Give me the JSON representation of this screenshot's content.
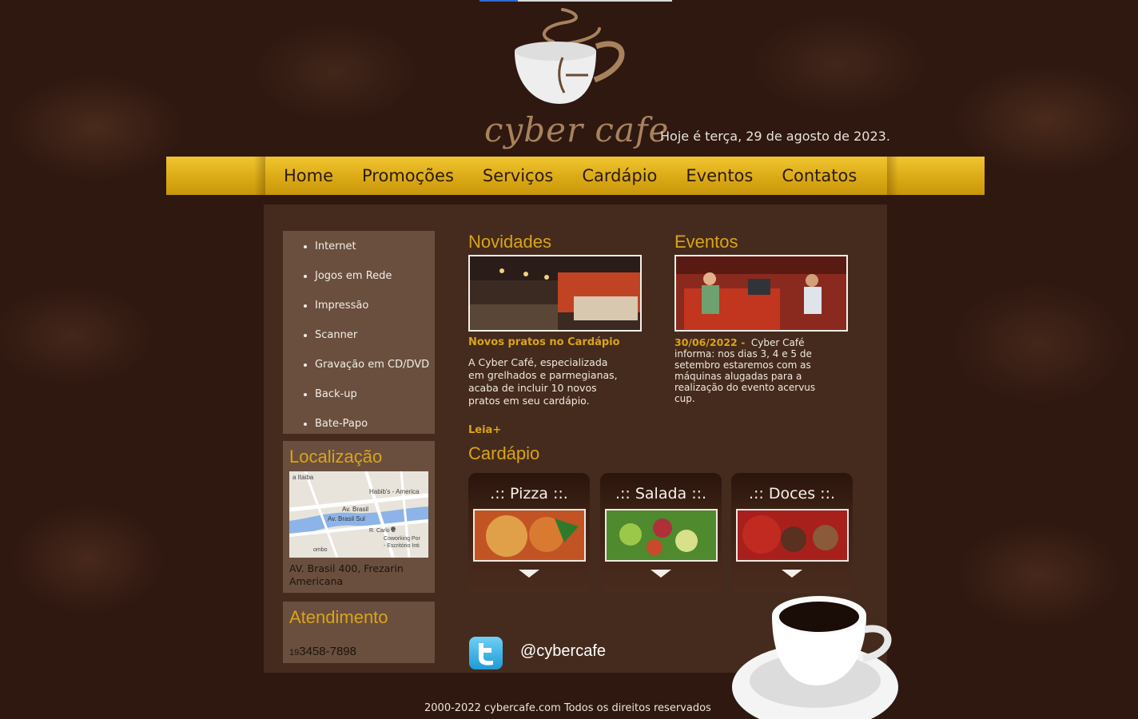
{
  "brand": {
    "name": "cyber cafe"
  },
  "header": {
    "date_text": "Hoje é terça, 29 de agosto de 2023."
  },
  "nav": {
    "items": [
      {
        "label": "Home"
      },
      {
        "label": "Promoções"
      },
      {
        "label": "Serviços"
      },
      {
        "label": "Cardápio"
      },
      {
        "label": "Eventos"
      },
      {
        "label": "Contatos"
      }
    ]
  },
  "services": {
    "items": [
      "Internet",
      "Jogos em Rede",
      "Impressão",
      "Scanner",
      "Gravação em CD/DVD",
      "Back-up",
      "Bate-Papo"
    ]
  },
  "location": {
    "title": "Localização",
    "address_line1": "AV. Brasil 400, Frezarin",
    "address_line2": "Americana",
    "map_labels": [
      "a Itaiba",
      "Habib's - America",
      "Av. Brasil",
      "Av. Brasil Sul",
      "R. Carlo C",
      "Coworking Por",
      "- Escritório Inti",
      "ombo"
    ]
  },
  "service_desk": {
    "title": "Atendimento",
    "area_code": "19",
    "phone": "3458-7898"
  },
  "news": {
    "heading": "Novidades",
    "title": "Novos pratos no Cardápio",
    "text": "A Cyber Café, especializada em grelhados e parmegianas, acaba de incluir 10 novos pratos em seu cardápio.",
    "read_more": "Leia+"
  },
  "events": {
    "heading": "Eventos",
    "date": "30/06/2022 -",
    "text": "Cyber Café informa: nos dias 3, 4 e 5 de setembro estaremos com as máquinas alugadas para a realização do evento acervus cup."
  },
  "menu": {
    "heading": "Cardápio",
    "cards": [
      {
        "label": ".:: Pizza ::."
      },
      {
        "label": ".:: Salada ::."
      },
      {
        "label": ".:: Doces ::."
      }
    ]
  },
  "social": {
    "twitter_handle": "@cybercafe"
  },
  "footer": {
    "text": "2000-2022 cybercafe.com Todos os direitos reservados"
  },
  "colors": {
    "accent": "#d9a41a",
    "nav": "#e2b11e",
    "background": "#2e1810"
  }
}
